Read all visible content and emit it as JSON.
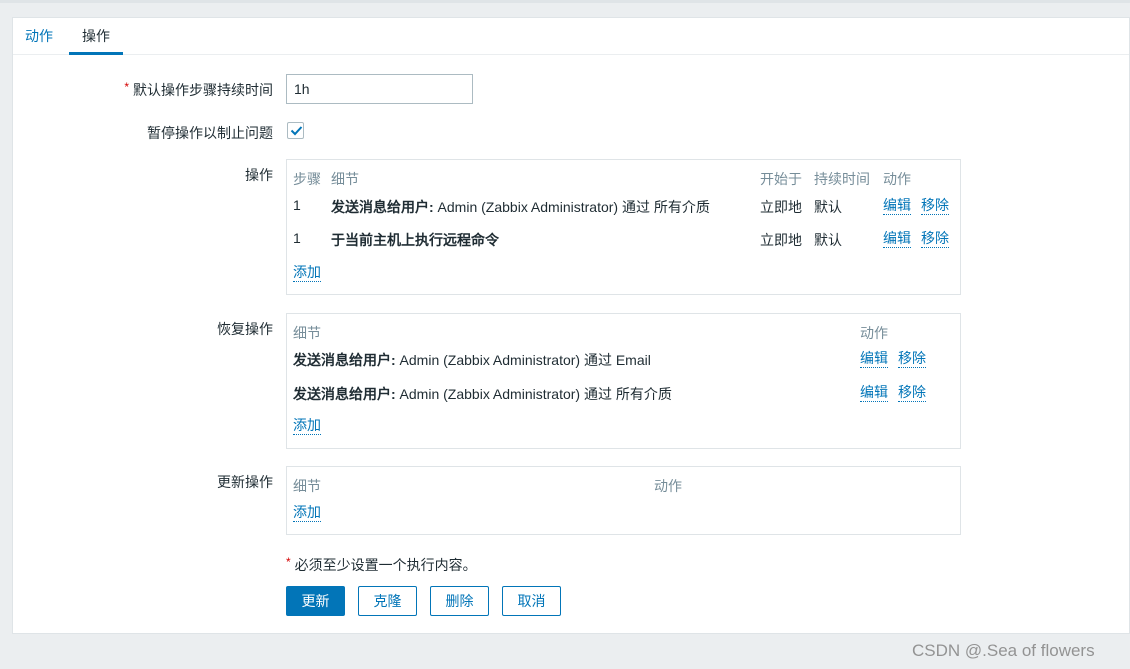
{
  "tabs": [
    {
      "label": "动作",
      "active": false
    },
    {
      "label": "操作",
      "active": true
    }
  ],
  "form": {
    "default_duration": {
      "label": "默认操作步骤持续时间",
      "required": true,
      "value": "1h"
    },
    "pause_suppressed": {
      "label": "暂停操作以制止问题",
      "checked": true
    }
  },
  "operations": {
    "label": "操作",
    "headers": {
      "step": "步骤",
      "details": "细节",
      "start_in": "开始于",
      "duration": "持续时间",
      "action": "动作"
    },
    "rows": [
      {
        "step": "1",
        "details_bold": "发送消息给用户:",
        "details_rest": " Admin (Zabbix Administrator) 通过 所有介质",
        "start_in": "立即地",
        "duration": "默认",
        "edit": "编辑",
        "remove": "移除"
      },
      {
        "step": "1",
        "details_bold": "于当前主机上执行远程命令",
        "details_rest": "",
        "start_in": "立即地",
        "duration": "默认",
        "edit": "编辑",
        "remove": "移除"
      }
    ],
    "add": "添加"
  },
  "recovery_operations": {
    "label": "恢复操作",
    "headers": {
      "details": "细节",
      "action": "动作"
    },
    "rows": [
      {
        "details_bold": "发送消息给用户:",
        "details_rest": " Admin (Zabbix Administrator) 通过 Email",
        "edit": "编辑",
        "remove": "移除"
      },
      {
        "details_bold": "发送消息给用户:",
        "details_rest": " Admin (Zabbix Administrator) 通过 所有介质",
        "edit": "编辑",
        "remove": "移除"
      }
    ],
    "add": "添加"
  },
  "update_operations": {
    "label": "更新操作",
    "headers": {
      "details": "细节",
      "action": "动作"
    },
    "add": "添加"
  },
  "note": {
    "required_mark": "*",
    "text": "必须至少设置一个执行内容。"
  },
  "buttons": {
    "update": "更新",
    "clone": "克隆",
    "delete": "删除",
    "cancel": "取消"
  },
  "watermark": "CSDN @.Sea of flowers",
  "colors": {
    "accent": "#0275b8",
    "required": "#d40000",
    "header_text": "#768d99"
  }
}
